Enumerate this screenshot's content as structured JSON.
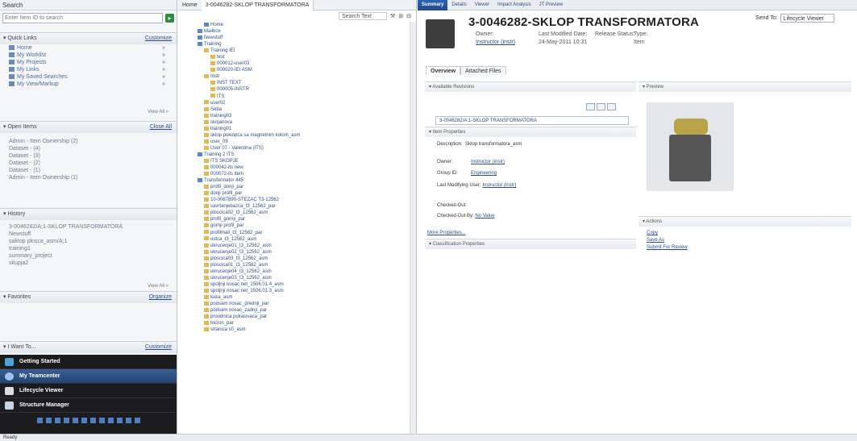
{
  "left_panel": {
    "search": {
      "header": "Search",
      "placeholder": "Enter Item ID to search"
    },
    "quick_links": {
      "title": "▾ Quick Links",
      "action": "Customize",
      "items": [
        "Home",
        "My Worklist",
        "My Projects",
        "My Links",
        "My Saved Searches",
        "My View/Markup"
      ],
      "view_all": "View All »"
    },
    "open_items": {
      "title": "▾ Open Items",
      "action": "Close All",
      "items": [
        "Admin - Item Ownership (2)",
        "Dataset - (4)",
        "Dataset - (3)",
        "Dataset - (2)",
        "Dataset - (1)",
        "Admin - Item Ownership (1)"
      ]
    },
    "history": {
      "title": "▾ History",
      "items": [
        "3-0046282/A;1-SKLOP TRANSFORMATORA",
        "Newstuff",
        "saktop plosca_asm/A;1",
        "training1",
        "summary_project",
        "skupja2"
      ],
      "view_all": "View All »"
    },
    "favorites": {
      "title": "▾ Favorites",
      "action": "Organize"
    },
    "i_want_to": {
      "title": "▾ I Want To...",
      "action": "Customize"
    },
    "applications": [
      "Getting Started",
      "My Teamcenter",
      "Lifecycle Viewer",
      "Structure Manager"
    ]
  },
  "middle_panel": {
    "tabs": [
      "Home",
      "3-0046282-SKLOP TRANSFORMATORA"
    ],
    "search_label": "Search Text",
    "tree": [
      "Home",
      "Mailbox",
      "Newstuff",
      "Training",
      "Training IEI",
      "test",
      "000012-user03",
      "000020-IEI ASM",
      "Instr",
      "INST TEXT",
      "000005-INSTR",
      "ITS",
      "user02",
      "Seba",
      "training03",
      "skojanova",
      "training01",
      "sklop pokiopca sa magnetnim kolom_asm",
      "user_09",
      "User 07 - Valentina (ITS)",
      "Training 2 ITS",
      "ITS SKOPJE",
      "000042-its new",
      "000072-its item",
      "Transformator 445",
      "profil_donji_par",
      "donji profil_par",
      "10-0067890-STEZAC T3-12562",
      "savrtanjebazca_t3_12562_par",
      "ploscica02_t3_12562_asm",
      "profil_gornji_par",
      "gornji profil_par",
      "profilmali_t3_12562_par",
      "ustca_t3_12562_asm",
      "ukrucenje01_t3_12562_asm",
      "ukrucenje02_t3_12562_asm",
      "ploscica03_t3_12562_asm",
      "ploscica01_t3_12562_asm",
      "ukrucenje04_t3_12562_asm",
      "ukrucenje03_t3_12562_asm",
      "spoljnji nosac net_1506.01.4_asm",
      "spoljnji nosac net_1506.01.3_asm",
      "kuka_asm",
      "podsam nosac_prednji_par",
      "podsam nosac_zadnji_par",
      "proudnica pokasivaca_par",
      "trezon_par",
      "stranica s0_asm"
    ]
  },
  "right_panel": {
    "tabs": [
      "Summary",
      "Details",
      "Viewer",
      "Impact Analysis",
      "JT Preview"
    ],
    "title": "3-0046282-SKLOP TRANSFORMATORA",
    "owner_label": "Owner:",
    "owner_value": "Instructor (instr)",
    "last_modified_label": "Last Modified Date:",
    "last_modified_value": "24-May-2011 10:31",
    "release_status_label": "Release Status:",
    "type_label": "Type:",
    "type_value": "Item",
    "send_to_label": "Send To:",
    "send_to_value": "Lifecycle Viewer",
    "subtabs": [
      "Overview",
      "Attached Files"
    ],
    "available_revisions": {
      "title": "▾ Available Revisions",
      "revision": "3-0046282/A;1-SKLOP TRANSFORMATORA"
    },
    "item_properties": {
      "title": "▾ Item Properties",
      "description_label": "Description:",
      "description_value": "Sklop transformatora_asm",
      "owner_label": "Owner:",
      "owner_value": "Instructor (instr)",
      "group_label": "Group ID:",
      "group_value": "Engineering",
      "last_modifying_label": "Last Modifying User:",
      "last_modifying_value": "Instructor (instr)",
      "checked_out_label": "Checked-Out:",
      "checked_out_by_label": "Checked-Out By:",
      "checked_out_by_value": "No Value",
      "more": "More Properties..."
    },
    "classification": {
      "title": "▾ Classification Properties"
    },
    "preview": {
      "title": "▾ Preview"
    },
    "actions": {
      "title": "▾ Actions",
      "items": [
        "Copy",
        "Save As",
        "Submit For Review"
      ]
    }
  },
  "status_bar": {
    "text": "Ready"
  },
  "colors": {
    "accent": "#2e62b0",
    "link": "#2c4e87",
    "dark_nav": "#1c1c1f"
  }
}
